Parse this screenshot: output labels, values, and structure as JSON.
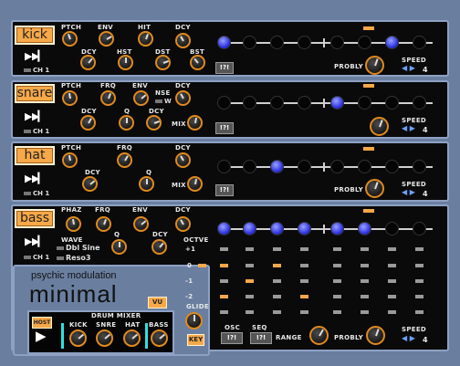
{
  "tracks": {
    "kick": {
      "name": "kick",
      "channel": "CH 1",
      "knobs": [
        "PTCH",
        "ENV",
        "HIT",
        "DCY",
        "DCY",
        "HST",
        "DST",
        "BST"
      ],
      "probly": "PROBLY",
      "speed_label": "SPEED",
      "speed": "4",
      "seq_button": "!?!"
    },
    "snare": {
      "name": "snare",
      "channel": "CH 1",
      "knobs": [
        "PTCH",
        "FRQ",
        "ENV",
        "NSE",
        "DCY",
        "DCY",
        "Q",
        "DCY",
        "MIX"
      ],
      "nse_w": "W",
      "probly": "PROBLY",
      "speed_label": "SPEED",
      "speed": "4",
      "seq_button": "!?!"
    },
    "hat": {
      "name": "hat",
      "channel": "CH 1",
      "knobs": [
        "PTCH",
        "FRQ",
        "DCY",
        "DCY",
        "Q",
        "MIX"
      ],
      "probly": "PROBLY",
      "speed_label": "SPEED",
      "speed": "4",
      "seq_button": "!?!"
    },
    "bass": {
      "name": "bass",
      "channel": "CH 1",
      "knobs": [
        "PHAZ",
        "FRQ",
        "ENV",
        "DCY",
        "Q",
        "DCY"
      ],
      "wave_label": "WAVE",
      "wave_options": [
        "Dbl Sine",
        "Reso3"
      ],
      "octave_label": "OCTVE",
      "octave_marks": [
        "+1",
        "0",
        "-1",
        "-2"
      ],
      "glide_label": "GLIDE",
      "key_button": "KEY",
      "osc_label": "OSC",
      "seq_label": "SEQ",
      "osc_button": "!?!",
      "seq_button": "!?!",
      "range_label": "RANGE",
      "probly": "PROBLY",
      "speed_label": "SPEED",
      "speed": "4"
    }
  },
  "brand": {
    "line1": "psychic modulation",
    "line2": "minimal",
    "vu_button": "VU"
  },
  "mixer": {
    "host_button": "HOST",
    "title": "DRUM MIXER",
    "channels": [
      "KICK",
      "SNRE",
      "HAT",
      "BASS"
    ]
  },
  "sequences": {
    "kick": [
      1,
      0,
      0,
      0,
      0,
      0,
      1,
      0
    ],
    "snare": [
      0,
      0,
      0,
      0,
      1,
      0,
      0,
      0
    ],
    "hat": [
      0,
      0,
      1,
      0,
      0,
      0,
      0,
      0
    ],
    "bass": [
      1,
      1,
      1,
      1,
      1,
      1,
      0,
      0
    ]
  }
}
